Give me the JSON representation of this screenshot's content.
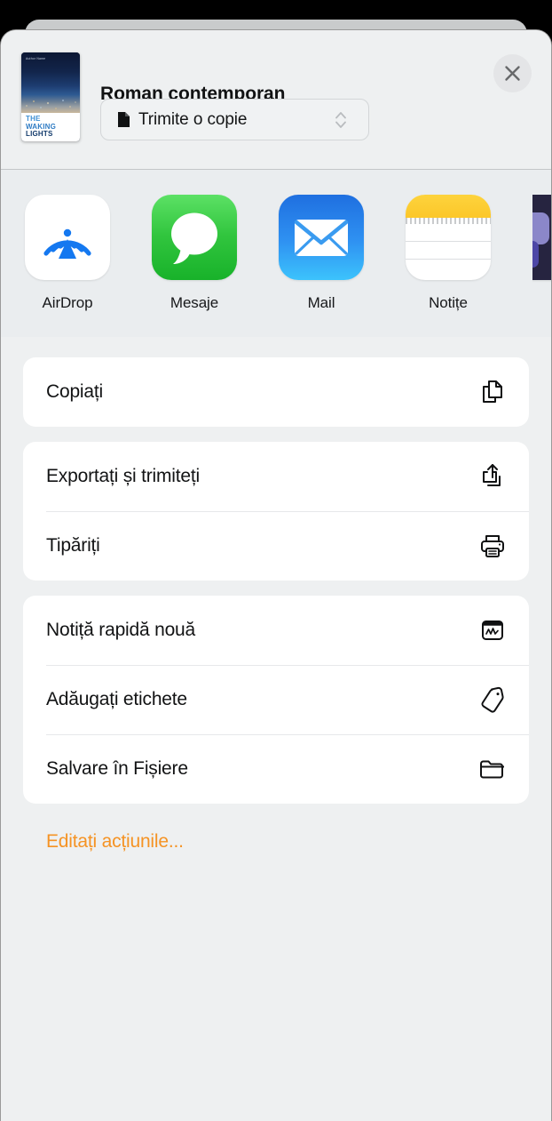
{
  "window": {
    "background_color": "#000000",
    "sheet_background": "#eef0f1"
  },
  "header": {
    "title": "Roman contemporan",
    "close_label": "×",
    "close_icon": "close-icon",
    "thumbnail": {
      "icon": "book-cover-thumbnail",
      "author": "Author Name",
      "title_line1": "THE",
      "title_line2": "WAKING",
      "title_line3": "LIGHTS"
    },
    "format_selector": {
      "icon": "document-icon",
      "value": "Trimite o copie",
      "chevron_icon": "chevron-up-down-icon"
    }
  },
  "apps": [
    {
      "label": "AirDrop",
      "icon": "airdrop-icon"
    },
    {
      "label": "Mesaje",
      "icon": "messages-icon"
    },
    {
      "label": "Mail",
      "icon": "mail-icon"
    },
    {
      "label": "Notițe",
      "icon": "notes-icon"
    },
    {
      "label": "",
      "icon": "partial-app-icon"
    }
  ],
  "action_groups": [
    {
      "rows": [
        {
          "label": "Copiați",
          "icon": "copy-icon"
        }
      ]
    },
    {
      "rows": [
        {
          "label": "Exportați și trimiteți",
          "icon": "share-icon"
        },
        {
          "label": "Tipăriți",
          "icon": "printer-icon"
        }
      ]
    },
    {
      "rows": [
        {
          "label": "Notiță rapidă nouă",
          "icon": "quick-note-icon"
        },
        {
          "label": "Adăugați etichete",
          "icon": "tag-icon"
        },
        {
          "label": "Salvare în Fișiere",
          "icon": "folder-icon"
        }
      ]
    }
  ],
  "footer": {
    "edit_actions_label": "Editați acțiunile...",
    "accent_color": "#f59324"
  }
}
